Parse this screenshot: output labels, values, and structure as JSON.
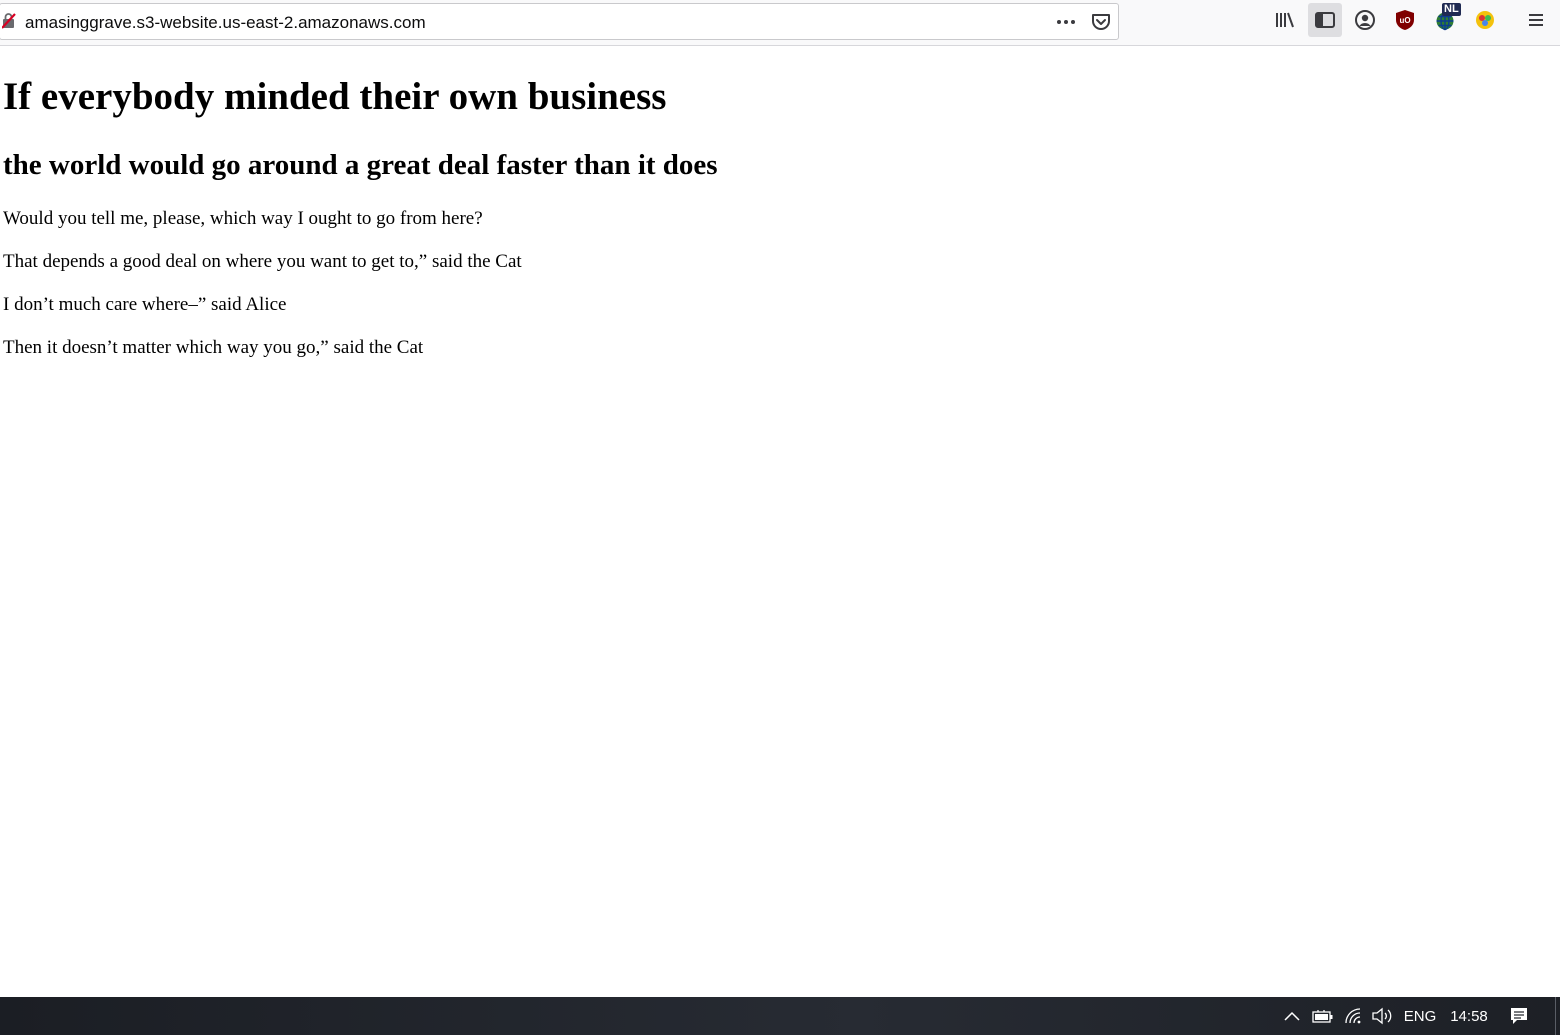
{
  "browser": {
    "url": "amasinggrave.s3-website.us-east-2.amazonaws.com",
    "toolbar_icons": [
      "library-icon",
      "sidebar-icon",
      "account-icon",
      "ublock-icon",
      "language-extension-icon",
      "multicolor-extension-icon",
      "menu-icon"
    ],
    "language_badge": "NL"
  },
  "page": {
    "heading1": "If everybody minded their own business",
    "heading2": "the world would go around a great deal faster than it does",
    "paragraphs": [
      "Would you tell me, please, which way I ought to go from here?",
      "That depends a good deal on where you want to get to,” said the Cat",
      "I don’t much care where–” said Alice",
      "Then it doesn’t matter which way you go,” said the Cat"
    ]
  },
  "taskbar": {
    "language": "ENG",
    "time": "14:58"
  }
}
